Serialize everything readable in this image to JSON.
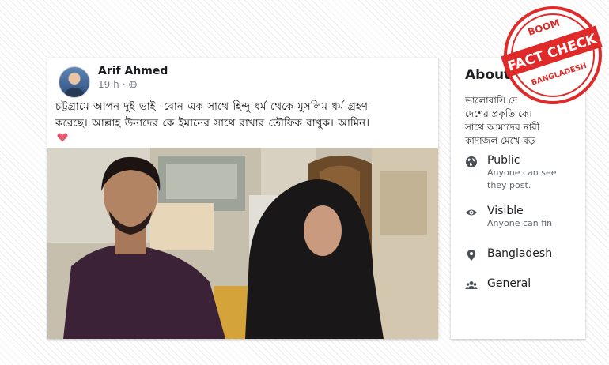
{
  "post": {
    "author": "Arif Ahmed",
    "time": "19 h",
    "separator": "·",
    "text_line1": "চট্টগ্রামে আপন দুই ভাই -বোন এক সাথে হিন্দু ধর্ম থেকে মুসলিম ধর্ম গ্রহণ",
    "text_line2": "করেছে। আল্লাহ উনাদের কে ইমানের সাথে রাখার তৌফিক রাখুক। আমিন।"
  },
  "about": {
    "title": "About",
    "desc_lines": [
      "ভালোবাসি দে",
      "দেশের প্রকৃতি কে।",
      "সাথে আমাদের নারী",
      "কাদাজল মেখে বড়"
    ],
    "items": [
      {
        "icon": "globe-icon",
        "title": "Public",
        "sub1": "Anyone can see",
        "sub2": "they post."
      },
      {
        "icon": "eye-icon",
        "title": "Visible",
        "sub1": "Anyone can fin",
        "sub2": ""
      },
      {
        "icon": "location-pin-icon",
        "title": "Bangladesh",
        "sub1": "",
        "sub2": ""
      },
      {
        "icon": "group-icon",
        "title": "General",
        "sub1": "",
        "sub2": ""
      }
    ]
  },
  "stamp": {
    "top": "BOOM",
    "main": "FACT CHECK",
    "bottom": "BANGLADESH"
  },
  "colors": {
    "stamp_red": "#e02a2a",
    "heart": "#e85a6b"
  }
}
